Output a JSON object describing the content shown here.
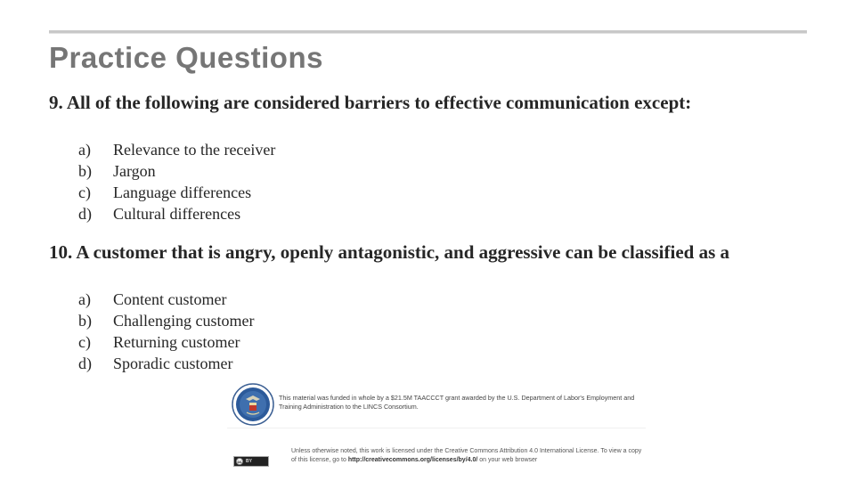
{
  "slide": {
    "title": "Practice Questions",
    "questions": [
      {
        "prompt": "9. All of the following are considered barriers to effective communication except:",
        "options": [
          {
            "letter": "a)",
            "text": "Relevance to the receiver"
          },
          {
            "letter": "b)",
            "text": "Jargon"
          },
          {
            "letter": "c)",
            "text": "Language differences"
          },
          {
            "letter": "d)",
            "text": "Cultural differences"
          }
        ]
      },
      {
        "prompt": "10. A customer that is angry, openly antagonistic, and aggressive can be classified as a",
        "options": [
          {
            "letter": "a)",
            "text": "Content customer"
          },
          {
            "letter": "b)",
            "text": "Challenging customer"
          },
          {
            "letter": "c)",
            "text": "Returning customer"
          },
          {
            "letter": "d)",
            "text": "Sporadic customer"
          }
        ]
      }
    ]
  },
  "footer": {
    "seal_icon": "dol-seal-icon",
    "funding_line1": "This material was funded in whole by a $21.5M TAACCCT grant awarded by the U.S. Department of Labor's Employment and",
    "funding_line2": "Training Administration to the LINCS Consortium.",
    "cc_badge_left": "cc",
    "cc_badge_right": "BY",
    "license_line1": "Unless otherwise noted, this work is licensed under the Creative Commons Attribution 4.0 International License. To view a copy",
    "license_line2_prefix": "of this license, go to ",
    "license_link": "http://creativecommons.org/licenses/by/4.0/",
    "license_line2_suffix": " on your web browser"
  },
  "colors": {
    "title": "#767676",
    "body_text": "#262626",
    "rule": "#c8c8c8",
    "seal_blue": "#2c5a9a"
  }
}
